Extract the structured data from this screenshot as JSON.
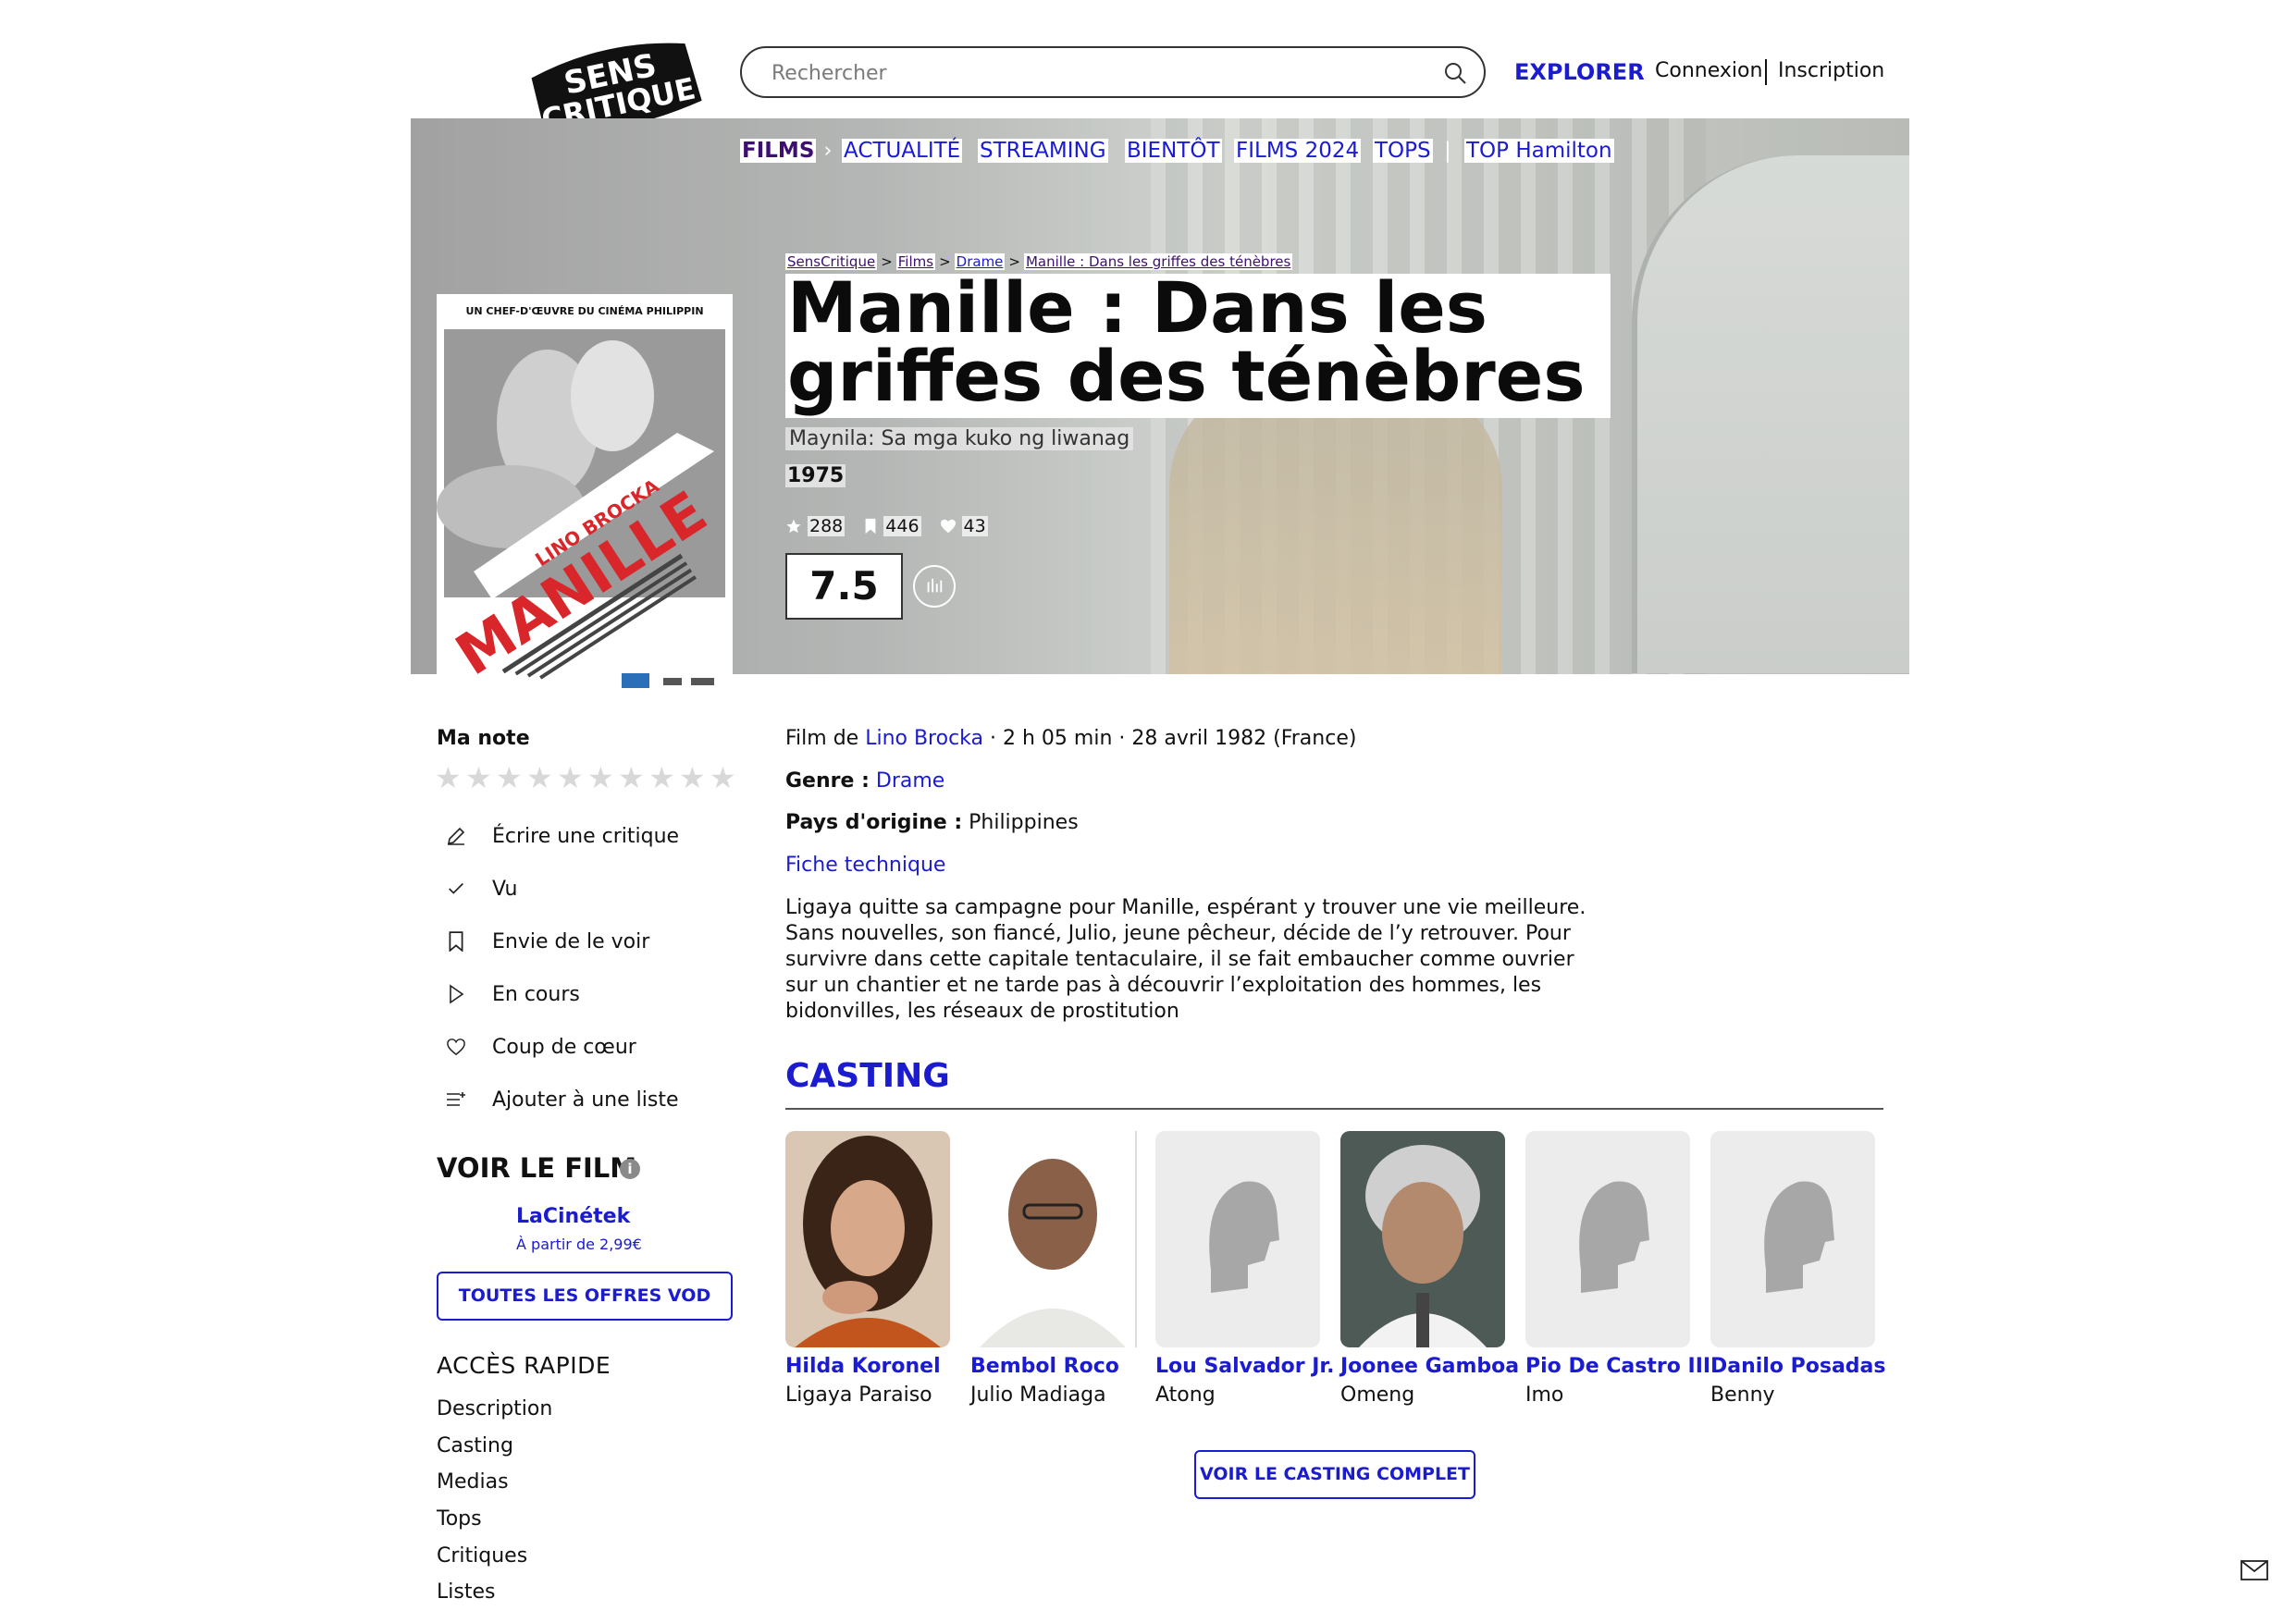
{
  "header": {
    "logo_text": "SENS CRITIQUE",
    "search_placeholder": "Rechercher",
    "explorer": "EXPLORER",
    "connexion": "Connexion",
    "inscription": "Inscription"
  },
  "nav": {
    "items": [
      "FILMS",
      "ACTUALITÉ",
      "STREAMING",
      "BIENTÔT",
      "FILMS 2024",
      "TOPS",
      "TOP Hamilton"
    ],
    "chevron": "›",
    "divider": "|"
  },
  "breadcrumb": {
    "items": [
      "SensCritique",
      "Films",
      "Drame",
      "Manille : Dans les griffes des ténèbres"
    ],
    "separator": ">"
  },
  "movie": {
    "title": "Manille : Dans les griffes des ténèbres",
    "original_title": "Maynila: Sa mga kuko ng liwanag",
    "year": "1975",
    "ratings_count": "288",
    "wishlist_count": "446",
    "favorites_count": "43",
    "average_rating": "7.5"
  },
  "poster": {
    "tagline": "UN CHEF-D'ŒUVRE DU CINÉMA PHILIPPIN",
    "title": "MANILLE",
    "director": "LINO BROCKA"
  },
  "sidebar": {
    "my_rating_label": "Ma note",
    "star_count": 10,
    "actions": [
      {
        "label": "Écrire une critique",
        "icon": "pencil-icon"
      },
      {
        "label": "Vu",
        "icon": "check-icon"
      },
      {
        "label": "Envie de le voir",
        "icon": "bookmark-icon"
      },
      {
        "label": "En cours",
        "icon": "play-icon"
      },
      {
        "label": "Coup de cœur",
        "icon": "heart-icon"
      },
      {
        "label": "Ajouter à une liste",
        "icon": "list-add-icon"
      }
    ],
    "watch_title": "VOIR LE FILM",
    "provider_name": "LaCinétek",
    "provider_price": "À partir de 2,99€",
    "all_vod_button": "TOUTES LES OFFRES VOD",
    "quick_access_title": "ACCÈS RAPIDE",
    "quick_links": [
      "Description",
      "Casting",
      "Medias",
      "Tops",
      "Critiques",
      "Listes"
    ]
  },
  "info": {
    "film_by_prefix": "Film de",
    "director": "Lino Brocka",
    "duration_date": "· 2 h 05 min · 28 avril 1982 (France)",
    "genre_label": "Genre :",
    "genre": "Drame",
    "country_label": "Pays d'origine :",
    "country": "Philippines",
    "technical_sheet": "Fiche technique",
    "synopsis": "Ligaya quitte sa campagne pour Manille, espérant y trouver une vie meilleure. Sans nouvelles, son fiancé, Julio, jeune pêcheur, décide de l’y retrouver. Pour survivre dans cette capitale tentaculaire, il se fait embaucher comme ouvrier sur un chantier et ne tarde pas à découvrir l’exploitation des hommes, les bidonvilles, les réseaux de prostitution"
  },
  "casting": {
    "title": "CASTING",
    "actors": [
      {
        "name": "Hilda Koronel",
        "role": "Ligaya Paraiso",
        "photo": "actress-photo"
      },
      {
        "name": "Bembol Roco",
        "role": "Julio Madiaga",
        "photo": "actor-photo"
      },
      {
        "name": "Lou Salvador Jr.",
        "role": "Atong",
        "photo": "placeholder-silhouette"
      },
      {
        "name": "Joonee Gamboa",
        "role": "Omeng",
        "photo": "actor-photo"
      },
      {
        "name": "Pio De Castro III",
        "role": "Imo",
        "photo": "placeholder-silhouette"
      },
      {
        "name": "Danilo Posadas",
        "role": "Benny",
        "photo": "placeholder-silhouette"
      }
    ],
    "full_cast_button": "VOIR LE CASTING COMPLET"
  },
  "colors": {
    "accent_blue": "#1b1bd0",
    "nav_films": "#3d0f6e"
  }
}
